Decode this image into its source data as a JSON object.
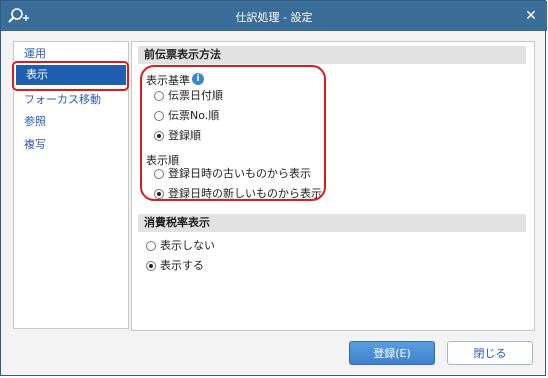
{
  "window": {
    "title": "仕訳処理 - 設定"
  },
  "sidebar": {
    "items": [
      {
        "label": "運用"
      },
      {
        "label": "表示"
      },
      {
        "label": "フォーカス移動"
      },
      {
        "label": "参照"
      },
      {
        "label": "複写"
      }
    ],
    "active": "表示"
  },
  "sections": {
    "previous_slip": {
      "title": "前伝票表示方法",
      "basis": {
        "label": "表示基準",
        "options": [
          "伝票日付順",
          "伝票No.順",
          "登録順"
        ],
        "selected": "登録順"
      },
      "order": {
        "label": "表示順",
        "options": [
          "登録日時の古いものから表示",
          "登録日時の新しいものから表示"
        ],
        "selected": "登録日時の新しいものから表示"
      }
    },
    "tax_rate": {
      "title": "消費税率表示",
      "options": [
        "表示しない",
        "表示する"
      ],
      "selected": "表示する"
    }
  },
  "buttons": {
    "register": "登録(E)",
    "close": "閉じる"
  },
  "colors": {
    "titlebar": "#3a6e99",
    "accent": "#1f5fb0",
    "highlight": "#e01a1a"
  }
}
